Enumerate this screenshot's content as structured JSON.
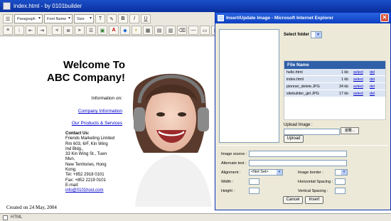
{
  "window": {
    "title": "index.html - by 0101builder"
  },
  "toolbar": {
    "row1": {
      "format_select": "Paragraph",
      "font_select": "Font Name",
      "size_select": "Size",
      "format_buttons": [
        "T",
        "B",
        "I",
        "U"
      ]
    }
  },
  "document": {
    "welcome_line1": "Welcome To",
    "welcome_line2": "ABC Company!",
    "info_on": "Information on:",
    "link_company": "Company Information",
    "link_products": "Our Products & Services",
    "contact": {
      "heading": "Contact Us:",
      "lines": [
        "Friends Marketing Limited",
        "Rm 603, 6/F, Kin Wing",
        "Ind Bldg.,",
        "33 Kin Wing St., Tuen",
        "Mun,",
        "New Territories, Hong",
        "Kong.",
        "Tel: +852 2918 0101",
        "Fax: +852 2219 0101",
        "E-mail:"
      ],
      "email": "info@0101host.com"
    },
    "created": "Created on 24 May, 2004"
  },
  "status_bar": {
    "html_label": "HTML"
  },
  "dialog": {
    "title": "Insert/Update Image - Microsoft Internet Explorer",
    "select_folder_label": "Select folder :",
    "file_table": {
      "header": "File Name",
      "rows": [
        {
          "name": "hello.html",
          "size": "1 kb",
          "select": "select",
          "del": "del"
        },
        {
          "name": "index.html",
          "size": "1 kb",
          "select": "select",
          "del": "del"
        },
        {
          "name": "pionner_delete.JPG",
          "size": "34 kb",
          "select": "select",
          "del": "del"
        },
        {
          "name": "sitebuilder_girl.JPG",
          "size": "17 kb",
          "select": "select",
          "del": "del"
        }
      ]
    },
    "upload_label": "Upload Image :",
    "browse_label": "瀏覽...",
    "upload_button": "Upload",
    "image_source_label": "Image source :",
    "alternate_text_label": "Alternate text :",
    "alignment_label": "Alignment :",
    "alignment_value": "<Not Set>",
    "image_border_label": "Image border :",
    "width_label": "Width :",
    "horizontal_spacing_label": "Horizontal Spacing :",
    "height_label": "Height :",
    "vertical_spacing_label": "Vertical Spacing :",
    "cancel_button": "Cancel",
    "insert_button": "Insert"
  }
}
